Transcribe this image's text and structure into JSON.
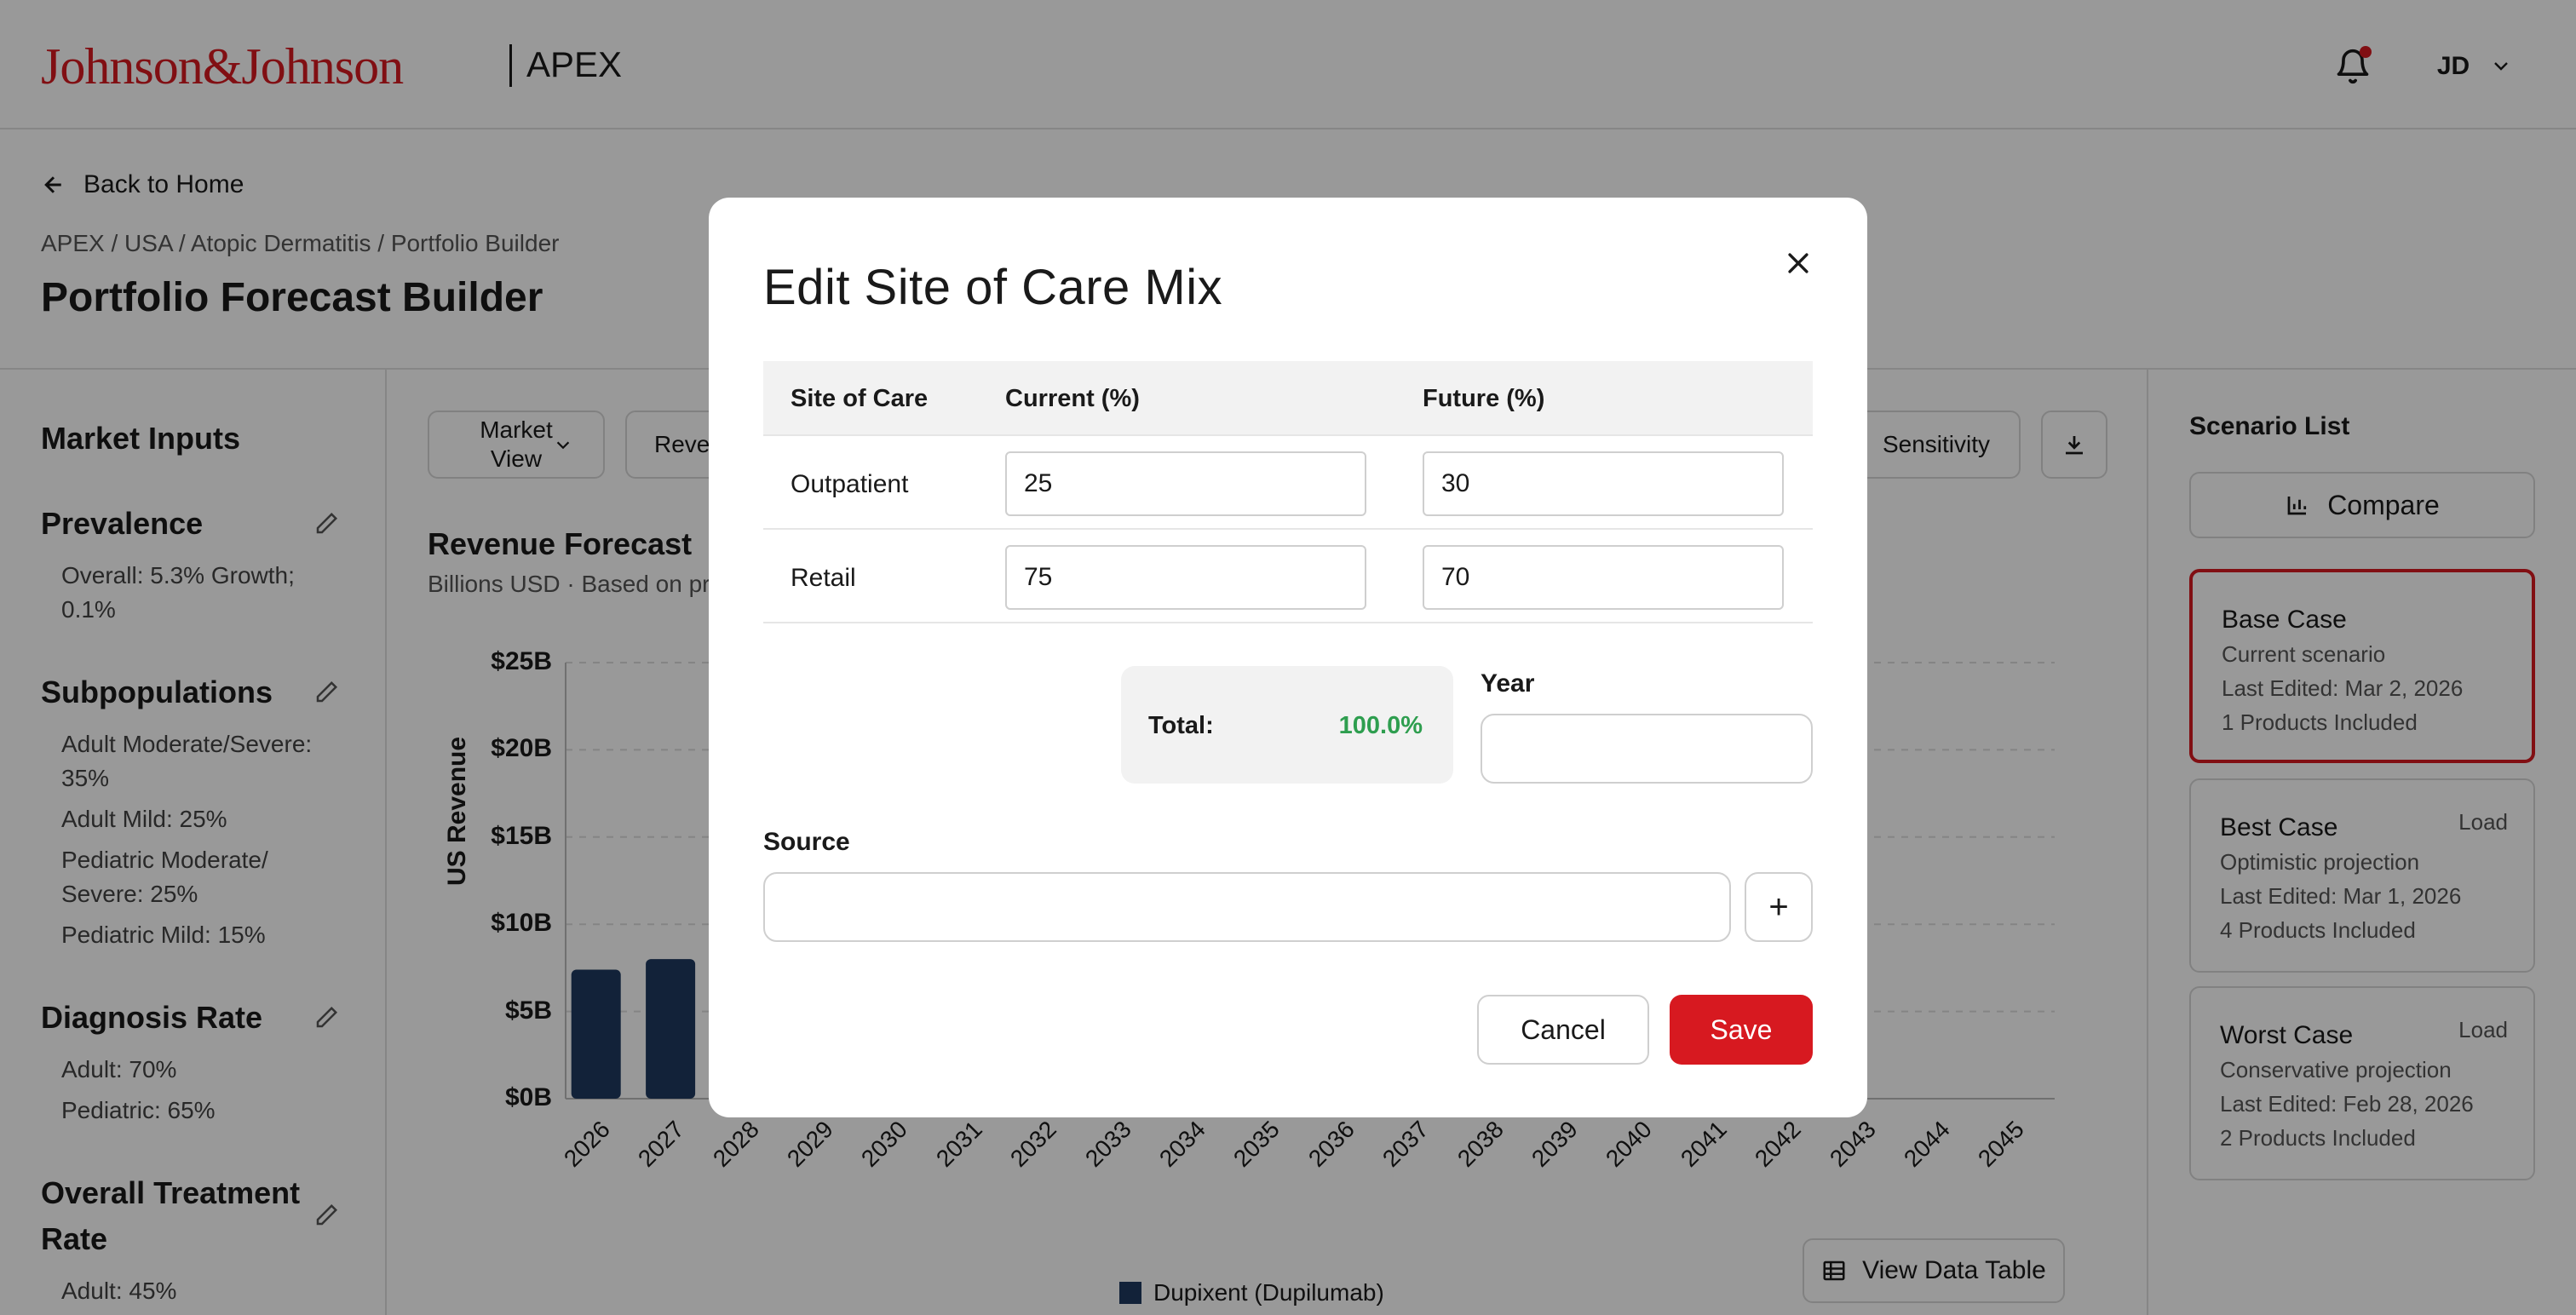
{
  "header": {
    "logo": "Johnson&Johnson",
    "app_name": "APEX",
    "user_initials": "JD",
    "icons": [
      "bell-icon",
      "chevron-down-icon"
    ]
  },
  "nav": {
    "back_label": "Back to Home",
    "breadcrumb": "APEX / USA / Atopic Dermatitis / Portfolio Builder",
    "page_title": "Portfolio Forecast Builder"
  },
  "sidebar": {
    "title": "Market Inputs",
    "sections": [
      {
        "title": "Prevalence",
        "lines": [
          "Overall: 5.3% Growth;",
          "0.1%"
        ]
      },
      {
        "title": "Subpopulations",
        "lines": [
          "Adult Moderate/Severe:",
          "35%",
          "Adult Mild: 25%",
          "Pediatric Moderate/",
          "Severe: 25%",
          "Pediatric Mild: 15%"
        ]
      },
      {
        "title": "Diagnosis Rate",
        "lines": [
          "Adult: 70%",
          "Pediatric: 65%"
        ]
      },
      {
        "title_line1": "Overall Treatment",
        "title_line2": "Rate",
        "lines": [
          "Adult: 45%"
        ]
      }
    ]
  },
  "toolbar": {
    "market_view_line1": "Market",
    "market_view_line2": "View",
    "revenue_partial": "Reve",
    "sensitivity_partial": "Sensitivity"
  },
  "chart": {
    "title": "Revenue Forecast",
    "subtitle_partial": "Billions USD · Based on pr",
    "view_table_label": "View Data Table"
  },
  "chart_data": {
    "type": "bar",
    "title": "Revenue Forecast",
    "ylabel": "US Revenue",
    "ylim": [
      0,
      25
    ],
    "yticks": [
      "$25B",
      "$20B",
      "$15B",
      "$10B",
      "$5B",
      "$0B"
    ],
    "categories": [
      "2026",
      "2027",
      "2028",
      "2029",
      "2030",
      "2031",
      "2032",
      "2033",
      "2034",
      "2035",
      "2036",
      "2037",
      "2038",
      "2039",
      "2040",
      "2041",
      "2042",
      "2043",
      "2044",
      "2045"
    ],
    "series": [
      {
        "name": "Dupixent (Dupilumab)",
        "color": "#1f3a5f",
        "visible_values": [
          7.4,
          8.0
        ]
      }
    ],
    "legend": "bottom-center",
    "grid": true
  },
  "scenarios": {
    "title": "Scenario List",
    "compare_label": "Compare",
    "items": [
      {
        "name": "Base Case",
        "desc": "Current scenario",
        "edited": "Last Edited: Mar 2, 2026",
        "products": "1 Products Included",
        "load": "",
        "active": true
      },
      {
        "name": "Best Case",
        "desc": "Optimistic projection",
        "edited": "Last Edited: Mar 1, 2026",
        "products": "4 Products Included",
        "load": "Load",
        "active": false
      },
      {
        "name": "Worst Case",
        "desc": "Conservative projection",
        "edited": "Last Edited: Feb 28, 2026",
        "products": "2 Products Included",
        "load": "Load",
        "active": false
      }
    ]
  },
  "modal": {
    "title": "Edit Site of Care Mix",
    "columns": [
      "Site of Care",
      "Current (%)",
      "Future (%)"
    ],
    "rows": [
      {
        "site": "Outpatient",
        "current": "25",
        "future": "30"
      },
      {
        "site": "Retail",
        "current": "75",
        "future": "70"
      }
    ],
    "total_label": "Total:",
    "total_value": "100.0%",
    "year_label": "Year",
    "year_value": "",
    "source_label": "Source",
    "source_value": "",
    "add_label": "+",
    "cancel_label": "Cancel",
    "save_label": "Save",
    "colors": {
      "accent": "#d71920",
      "total_ok": "#2e9e4f"
    }
  }
}
